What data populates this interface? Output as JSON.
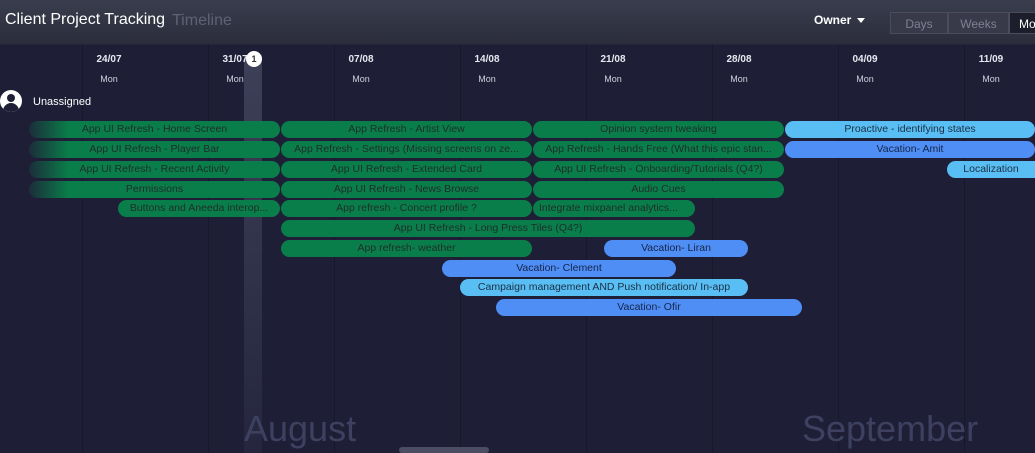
{
  "header": {
    "app_title": "Client Project Tracking",
    "view_title": "Timeline",
    "owner_label": "Owner",
    "view_modes": [
      "Days",
      "Weeks",
      "Mo"
    ],
    "active_view_mode": "Mo"
  },
  "timeline": {
    "dates": [
      {
        "date": "24/07",
        "weekday": "Mon"
      },
      {
        "date": "31/07",
        "weekday": "Mon"
      },
      {
        "date": "07/08",
        "weekday": "Mon"
      },
      {
        "date": "14/08",
        "weekday": "Mon"
      },
      {
        "date": "21/08",
        "weekday": "Mon"
      },
      {
        "date": "28/08",
        "weekday": "Mon"
      },
      {
        "date": "04/09",
        "weekday": "Mon"
      },
      {
        "date": "11/09",
        "weekday": "Mon"
      }
    ],
    "today_marker": "1",
    "months": [
      "August",
      "September"
    ]
  },
  "group": {
    "label": "Unassigned"
  },
  "items": [
    "App UI Refresh - Home Screen",
    "App UI Refresh - Player Bar",
    "App UI Refresh - Recent Activity",
    "Permissions",
    "Buttons and Aneeda interop...",
    "App Refresh - Artist View",
    "App Refresh - Settings (Missing screens on ze...",
    "App UI Refresh - Extended Card",
    "App UI Refresh - News Browse",
    "App refresh - Concert profile ?",
    "App UI Refresh - Long Press Tiles (Q4?)",
    "App refresh- weather",
    "Opinion system tweaking",
    "App Refresh - Hands Free (What this epic stan...",
    "App UI Refresh - Onboarding/Tutorials (Q4?)",
    "Audio Cues",
    "Integrate mixpanel analytics...",
    "Vacation- Liran",
    "Vacation- Clement",
    "Campaign management AND Push notification/ In-app",
    "Vacation- Ofir",
    "Proactive - identifying states",
    "Vacation- Amit",
    "Localization"
  ],
  "colors": {
    "background": "#1e1f37",
    "green": "#0a7e4a",
    "light_blue": "#58bef3",
    "blue": "#4f8ef5"
  }
}
